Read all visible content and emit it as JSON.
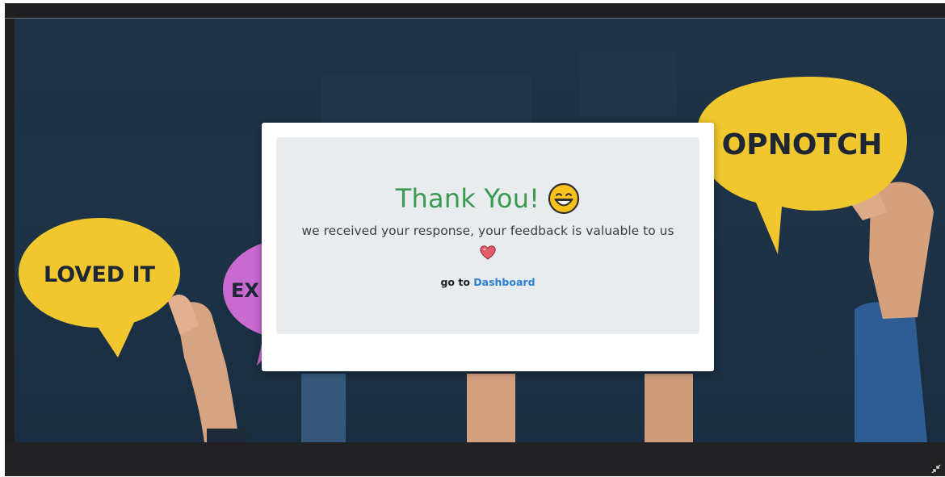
{
  "background": {
    "bubbles": [
      {
        "text": "LOVED IT",
        "color": "#f0c72f"
      },
      {
        "text": "EX",
        "color": "#c86ad0"
      },
      {
        "text": "OPNOTCH",
        "color": "#f0c72f"
      }
    ]
  },
  "modal": {
    "title": "Thank You!",
    "emoji_icon": "grinning-face-icon",
    "message": "we received your response, your feedback is valuable to us",
    "heart_icon": "heart-icon",
    "goto_prefix": "go to",
    "dashboard_link": "Dashboard"
  },
  "colors": {
    "title": "#3a9a52",
    "link": "#2a7fd1",
    "panel": "#e9ecef",
    "backdrop": "#1f3246"
  }
}
